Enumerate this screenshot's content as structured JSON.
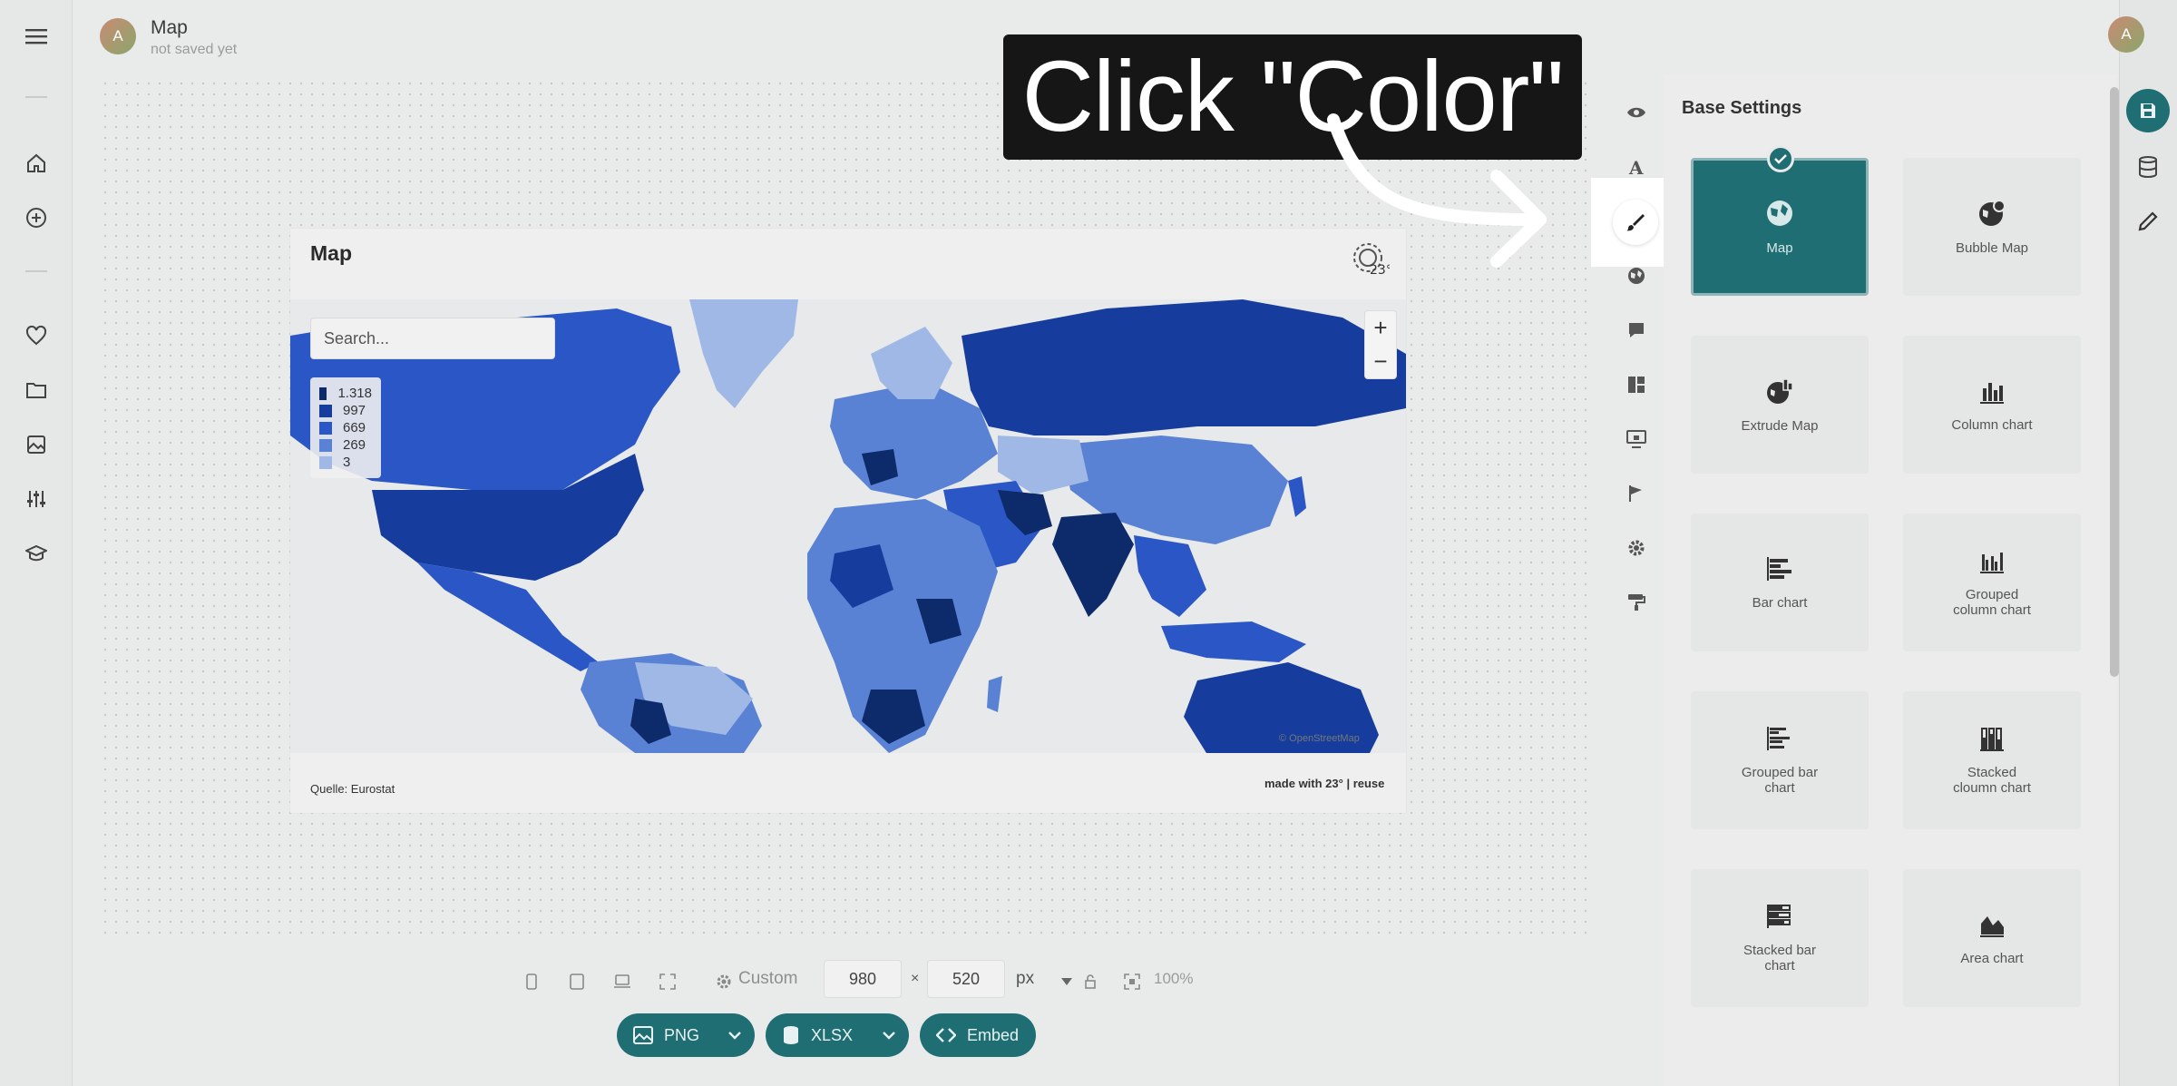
{
  "header": {
    "title": "Map",
    "subtitle": "not saved yet",
    "avatar_initial": "A"
  },
  "left_nav": [
    "menu-icon",
    "home-icon",
    "add-circle-icon",
    "heart-icon",
    "folder-icon",
    "image-icon",
    "sliders-icon",
    "graduation-cap-icon"
  ],
  "chart": {
    "title": "Map",
    "search_placeholder": "Search...",
    "legend": [
      {
        "label": "1.318",
        "color": "#0d2a6b"
      },
      {
        "label": "997",
        "color": "#163d9e"
      },
      {
        "label": "669",
        "color": "#2a56c6"
      },
      {
        "label": "269",
        "color": "#5a82d4"
      },
      {
        "label": "3",
        "color": "#9fb8e6"
      }
    ],
    "zoom_in": "+",
    "zoom_out": "−",
    "attribution": "© OpenStreetMap",
    "source": "Quelle: Eurostat",
    "made_with": "made with 23° | reuse"
  },
  "toolbar": {
    "custom_label": "Custom",
    "width": "980",
    "times": "×",
    "height": "520",
    "unit": "px",
    "zoom": "100%",
    "exports": [
      {
        "label": "PNG",
        "icon": "image-icon"
      },
      {
        "label": "XLSX",
        "icon": "database-icon"
      },
      {
        "label": "Embed",
        "icon": "code-icon"
      }
    ]
  },
  "tools": [
    "eye-icon",
    "font-icon",
    "brush-icon",
    "globe-icon",
    "comment-icon",
    "layout-icon",
    "monitor-icon",
    "flag-icon",
    "gear-icon",
    "paint-roller-icon"
  ],
  "panel": {
    "title": "Base Settings",
    "tiles": [
      {
        "label": "Map",
        "icon": "globe-icon",
        "active": true
      },
      {
        "label": "Bubble Map",
        "icon": "bubble-globe-icon",
        "active": false
      },
      {
        "label": "Extrude Map",
        "icon": "extrude-globe-icon",
        "active": false
      },
      {
        "label": "Column chart",
        "icon": "column-chart-icon",
        "active": false
      },
      {
        "label": "Bar chart",
        "icon": "bar-chart-icon",
        "active": false
      },
      {
        "label": "Grouped\ncolumn chart",
        "icon": "grouped-column-icon",
        "active": false
      },
      {
        "label": "Grouped bar\nchart",
        "icon": "grouped-bar-icon",
        "active": false
      },
      {
        "label": "Stacked\ncloumn chart",
        "icon": "stacked-column-icon",
        "active": false
      },
      {
        "label": "Stacked bar\nchart",
        "icon": "stacked-bar-icon",
        "active": false
      },
      {
        "label": "Area chart",
        "icon": "area-chart-icon",
        "active": false
      }
    ]
  },
  "right_rail": [
    "save-icon",
    "database-icon",
    "pencil-icon"
  ],
  "overlay": {
    "callout": "Click \"Color\""
  },
  "colors": {
    "accent": "#1f6e73",
    "map_dark": "#163d9e",
    "map_light": "#9fb8e6"
  }
}
